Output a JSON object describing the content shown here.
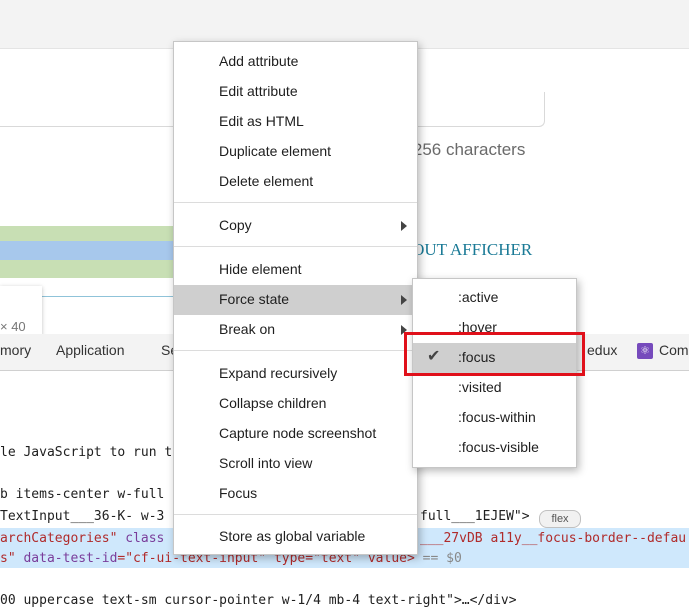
{
  "page": {
    "char_hint": "m 256 characters",
    "tout_link": "TOUT AFFICHER",
    "dims": "× 40"
  },
  "devtools": {
    "tabs": [
      "mory",
      "Application",
      "Se",
      "edux",
      "Com"
    ],
    "code_lines": {
      "l1": "le JavaScript to run t",
      "l2": "b items-center w-full",
      "l3a": "TextInput___36-K- w-3",
      "l3b": "full___1EJEW\">",
      "flex_badge": "flex",
      "l4a": "arc",
      "l4b": "hCategories\"",
      "l4c": " class",
      "l4d": "___27vDB a11y__focus-border--defau",
      "l5a": "s\"",
      "l5b": " data-test-id",
      "l5c": "=\"cf-ui-text-input\" type=\"text\" value>",
      "l5d": " == $0",
      "l6": "00 uppercase text-sm cursor-pointer w-1/4 mb-4 text-right\">…</div>"
    }
  },
  "context_menu": {
    "items": [
      "Add attribute",
      "Edit attribute",
      "Edit as HTML",
      "Duplicate element",
      "Delete element",
      "Copy",
      "Hide element",
      "Force state",
      "Break on",
      "Expand recursively",
      "Collapse children",
      "Capture node screenshot",
      "Scroll into view",
      "Focus",
      "Store as global variable"
    ]
  },
  "force_state_submenu": {
    "items": [
      ":active",
      ":hover",
      ":focus",
      ":visited",
      ":focus-within",
      ":focus-visible"
    ],
    "checked": ":focus",
    "check_glyph": "✔"
  },
  "colors": {
    "highlight_box": "#e0101a",
    "selected_row": "#cfe8fc"
  }
}
